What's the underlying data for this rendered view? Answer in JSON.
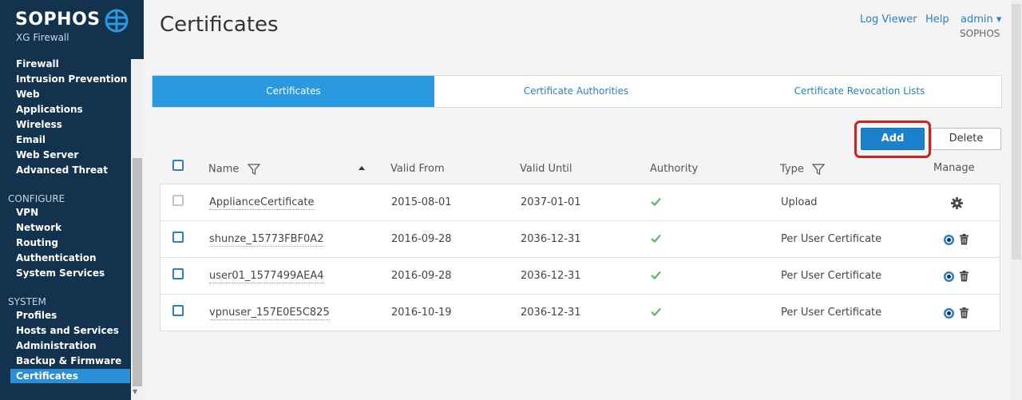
{
  "brand": {
    "name": "SOPHOS",
    "product": "XG Firewall"
  },
  "sidebar": {
    "partial_item": "Firewall",
    "protect_items": [
      "Intrusion Prevention",
      "Web",
      "Applications",
      "Wireless",
      "Email",
      "Web Server",
      "Advanced Threat"
    ],
    "configure_title": "CONFIGURE",
    "configure_items": [
      "VPN",
      "Network",
      "Routing",
      "Authentication",
      "System Services"
    ],
    "system_title": "SYSTEM",
    "system_items": [
      "Profiles",
      "Hosts and Services",
      "Administration",
      "Backup & Firmware",
      "Certificates"
    ],
    "active_item": "Certificates"
  },
  "header": {
    "title": "Certificates",
    "log_viewer": "Log Viewer",
    "help": "Help",
    "user": "admin ▾",
    "org": "SOPHOS"
  },
  "tabs": [
    "Certificates",
    "Certificate Authorities",
    "Certificate Revocation Lists"
  ],
  "toolbar": {
    "add_label": "Add",
    "delete_label": "Delete"
  },
  "columns": {
    "name": "Name",
    "valid_from": "Valid From",
    "valid_until": "Valid Until",
    "authority": "Authority",
    "type": "Type",
    "manage": "Manage"
  },
  "rows": [
    {
      "name": "ApplianceCertificate",
      "valid_from": "2015-08-01",
      "valid_until": "2037-01-01",
      "type": "Upload"
    },
    {
      "name": "shunze_15773FBF0A2",
      "valid_from": "2016-09-28",
      "valid_until": "2036-12-31",
      "type": "Per User Certificate"
    },
    {
      "name": "user01_1577499AEA4",
      "valid_from": "2016-09-28",
      "valid_until": "2036-12-31",
      "type": "Per User Certificate"
    },
    {
      "name": "vpnuser_157E0E5C825",
      "valid_from": "2016-10-19",
      "valid_until": "2036-12-31",
      "type": "Per User Certificate"
    }
  ],
  "colors": {
    "sidebar_bg": "#12324d",
    "accent": "#2a9ae0",
    "add_button": "#1c80cc",
    "check_green": "#5cb85c",
    "highlight_ring": "#d21f1f"
  }
}
